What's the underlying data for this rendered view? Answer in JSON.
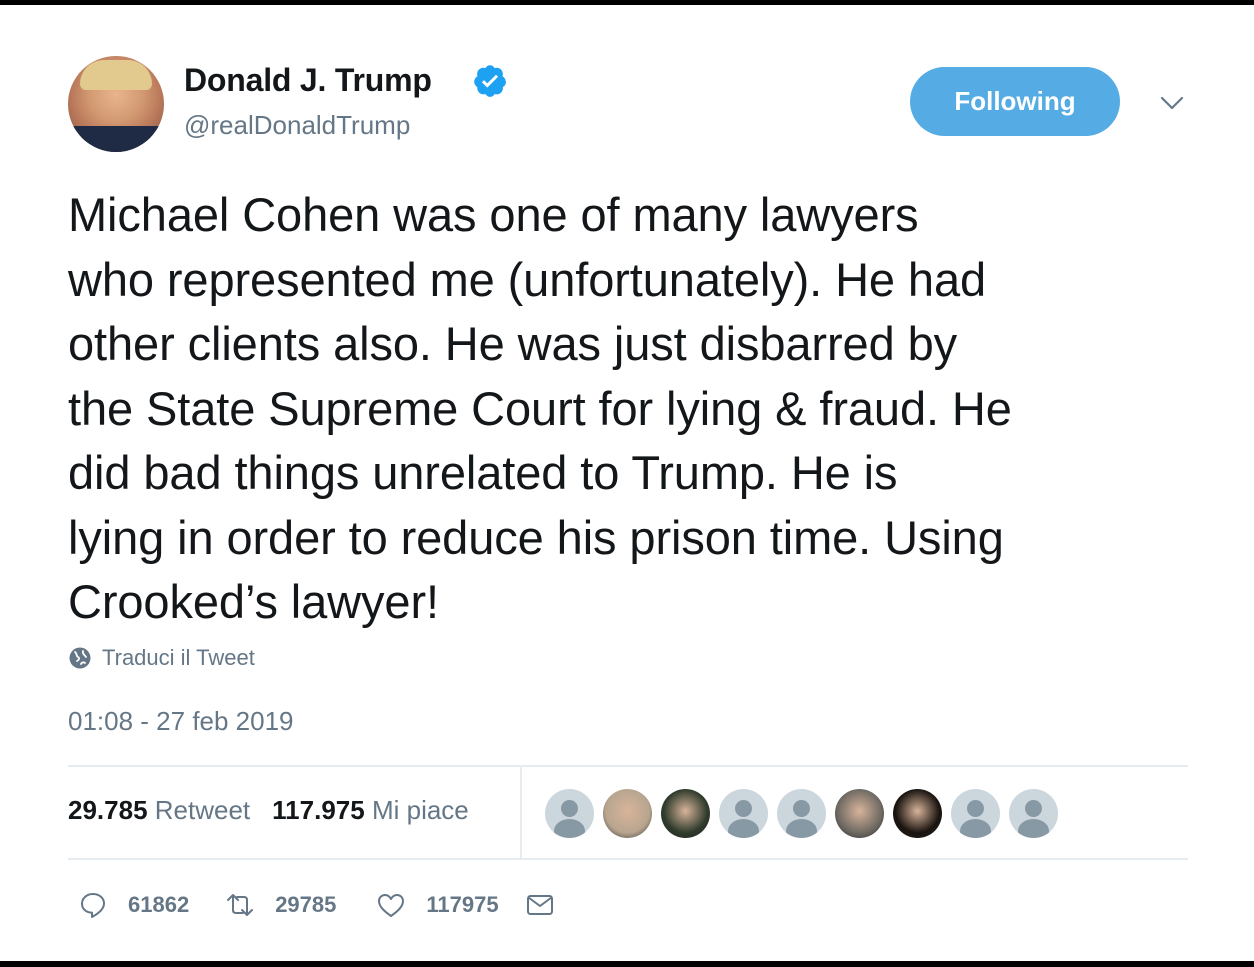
{
  "user": {
    "name": "Donald J. Trump",
    "handle": "@realDonaldTrump",
    "verified": true
  },
  "follow_button": {
    "label": "Following"
  },
  "tweet": {
    "lines": [
      "Michael Cohen was one of many lawyers",
      "who represented me (unfortunately). He had",
      "other clients also. He was just disbarred by",
      "the State Supreme Court for lying & fraud. He",
      "did bad things unrelated to Trump. He is",
      "lying in order to reduce his prison time. Using",
      "Crooked’s lawyer!"
    ],
    "translate_label": "Traduci il Tweet",
    "timestamp": "01:08 - 27 feb 2019"
  },
  "stats": {
    "retweets_count": "29.785",
    "retweets_label": "Retweet",
    "likes_count": "117.975",
    "likes_label": "Mi piace"
  },
  "liked_by_avatars": [
    {
      "kind": "default"
    },
    {
      "kind": "photo",
      "color": "#b8a58f"
    },
    {
      "kind": "photo",
      "color": "#2f3b2c"
    },
    {
      "kind": "default"
    },
    {
      "kind": "default"
    },
    {
      "kind": "photo",
      "color": "#6f6a63"
    },
    {
      "kind": "photo",
      "color": "#1a1410"
    },
    {
      "kind": "default"
    },
    {
      "kind": "default"
    }
  ],
  "actions": {
    "replies": "61862",
    "retweets": "29785",
    "likes": "117975"
  },
  "colors": {
    "accent": "#55ace4",
    "muted": "#657786",
    "text": "#14171a"
  }
}
